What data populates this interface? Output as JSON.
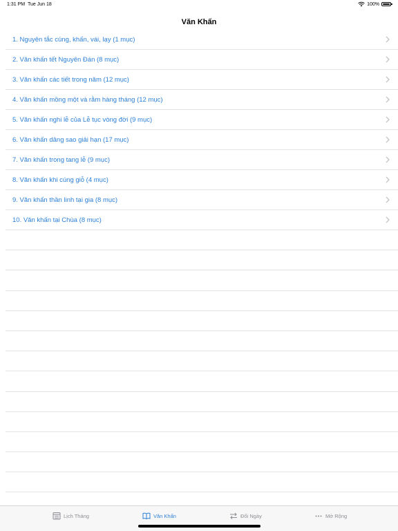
{
  "status_bar": {
    "time": "1:31 PM",
    "date": "Tue Jun 18",
    "battery": "100%"
  },
  "nav": {
    "title": "Văn Khấn"
  },
  "list": {
    "items": [
      "1. Nguyên tắc cúng, khấn, vái, lạy (1 mục)",
      "2. Văn khấn tết Nguyên Đán (8 mục)",
      "3. Văn khấn các tiết trong năm (12 mục)",
      "4. Văn khấn mồng một và rằm hàng tháng (12 mục)",
      "5. Văn khấn nghi lễ của Lễ tục vòng đời (9 mục)",
      "6. Văn khấn dâng sao giải hạn (17 mục)",
      "7. Văn khấn trong tang lễ (9 mục)",
      "8. Văn khấn khi cúng giỗ (4 mục)",
      "9. Văn khấn thần linh tại gia (8 mục)",
      "10. Văn khấn tại Chùa (8 mục)"
    ]
  },
  "tabs": [
    {
      "label": "Lịch Tháng",
      "icon": "calendar-icon",
      "active": false
    },
    {
      "label": "Văn Khấn",
      "icon": "book-icon",
      "active": true
    },
    {
      "label": "Đổi Ngày",
      "icon": "swap-arrows-icon",
      "active": false
    },
    {
      "label": "Mở Rộng",
      "icon": "more-icon",
      "active": false
    }
  ],
  "colors": {
    "accent": "#2c7fd6",
    "separator": "#e3e3e6",
    "inactive": "#8e8e93"
  }
}
